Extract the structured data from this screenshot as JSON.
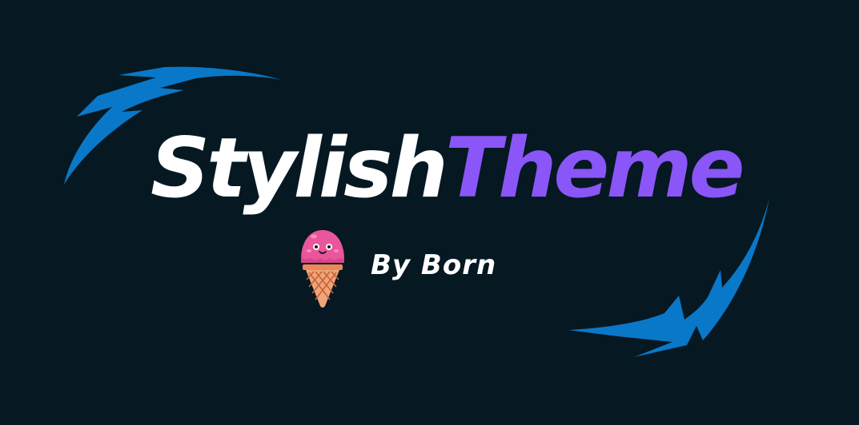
{
  "logo": {
    "title_part1": "Stylish",
    "title_part2": "Theme",
    "byline": "By Born"
  },
  "colors": {
    "background": "#061822",
    "title_part1": "#ffffff",
    "title_part2": "#8a56f7",
    "byline": "#ffffff",
    "swoosh": "#0a78c8",
    "ice_cream_scoop": "#e9569c",
    "ice_cream_cone": "#f0a47a"
  },
  "icons": {
    "swoosh_top_left": "lightning-swoosh-icon",
    "swoosh_bottom_right": "lightning-swoosh-icon",
    "mascot": "ice-cream-cone-icon"
  }
}
